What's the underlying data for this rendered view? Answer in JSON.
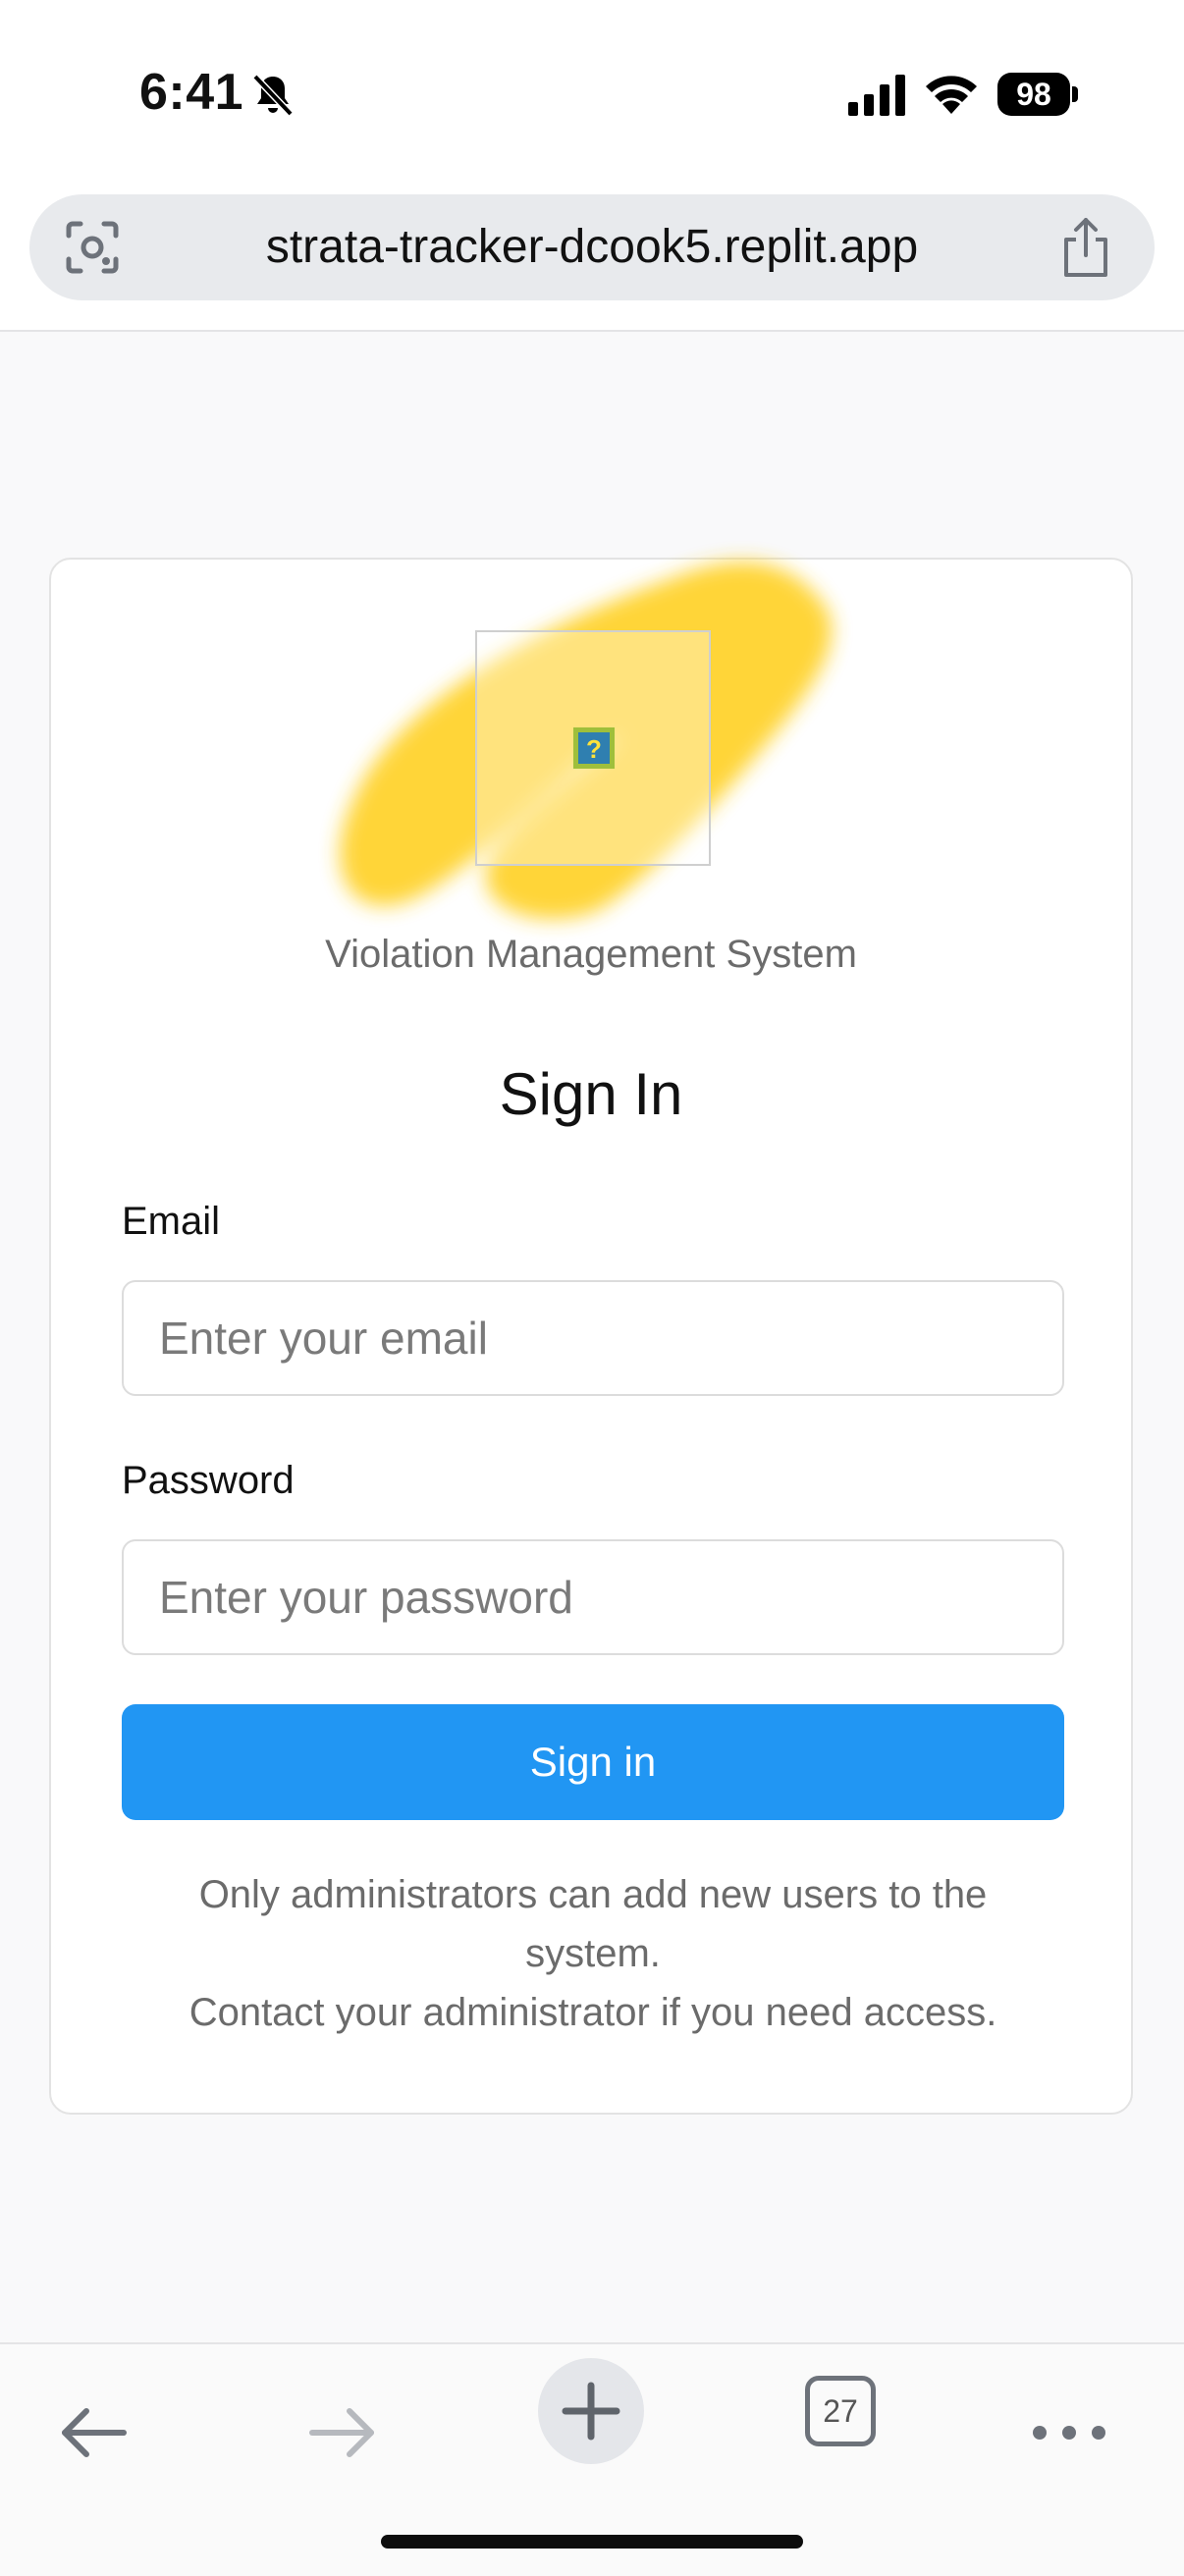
{
  "status_bar": {
    "time": "6:41",
    "battery": "98"
  },
  "browser": {
    "url": "strata-tracker-dcook5.replit.app",
    "tab_count": "27"
  },
  "card": {
    "system_title": "Violation Management System",
    "heading": "Sign In",
    "email": {
      "label": "Email",
      "placeholder": "Enter your email",
      "value": ""
    },
    "password": {
      "label": "Password",
      "placeholder": "Enter your password",
      "value": ""
    },
    "sign_in_button": "Sign in",
    "help_line1": "Only administrators can add new users to the",
    "help_line2": "system.",
    "help_line3": "Contact your administrator if you need access."
  },
  "colors": {
    "primary": "#2196f3",
    "logo_yellow": "#ffd430",
    "page_bg": "#f9f9fa"
  },
  "icons": [
    "mute-icon",
    "signal-icon",
    "wifi-icon",
    "battery-icon",
    "lens-icon",
    "share-icon",
    "broken-image-icon",
    "back-arrow-icon",
    "forward-arrow-icon",
    "plus-icon",
    "tabs-icon",
    "more-icon"
  ]
}
